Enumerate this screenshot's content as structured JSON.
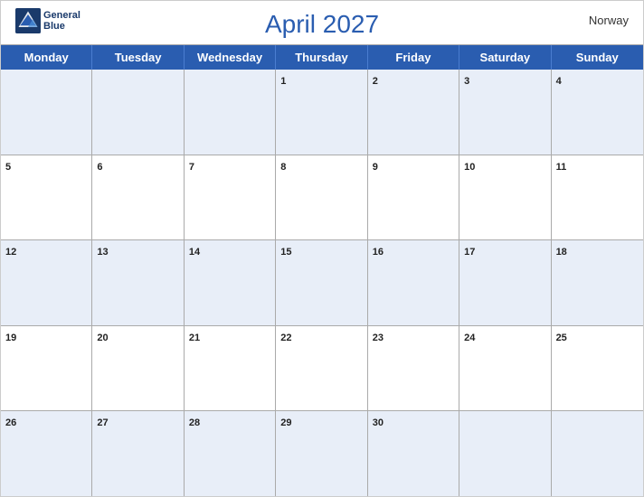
{
  "header": {
    "title": "April 2027",
    "country": "Norway"
  },
  "logo": {
    "line1": "General",
    "line2": "Blue"
  },
  "days": [
    "Monday",
    "Tuesday",
    "Wednesday",
    "Thursday",
    "Friday",
    "Saturday",
    "Sunday"
  ],
  "weeks": [
    [
      null,
      null,
      null,
      1,
      2,
      3,
      4
    ],
    [
      5,
      6,
      7,
      8,
      9,
      10,
      11
    ],
    [
      12,
      13,
      14,
      15,
      16,
      17,
      18
    ],
    [
      19,
      20,
      21,
      22,
      23,
      24,
      25
    ],
    [
      26,
      27,
      28,
      29,
      30,
      null,
      null
    ]
  ]
}
